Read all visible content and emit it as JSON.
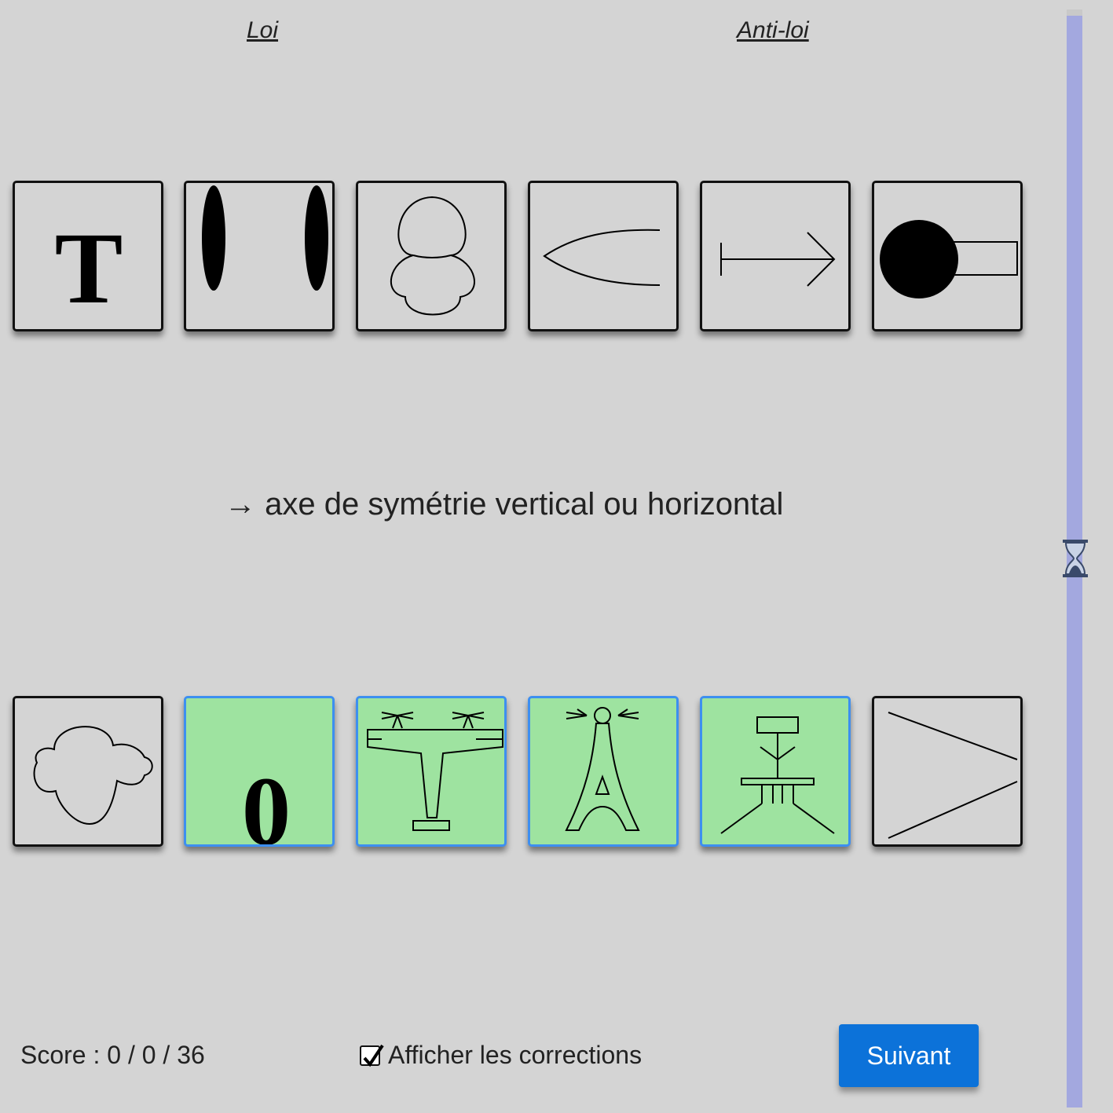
{
  "headers": {
    "law": "Loi",
    "anti_law": "Anti-loi"
  },
  "top_row": [
    {
      "id": "t1",
      "icon": "letter-T-icon",
      "letter": "T"
    },
    {
      "id": "t2",
      "icon": "two-vertical-ellipses-icon"
    },
    {
      "id": "t3",
      "icon": "stacked-bubble-shape-icon"
    },
    {
      "id": "t4",
      "icon": "lens-curve-icon"
    },
    {
      "id": "t5",
      "icon": "arrow-right-bar-icon"
    },
    {
      "id": "t6",
      "icon": "circle-with-rectangle-icon"
    }
  ],
  "rule_text": "→ axe de symétrie vertical ou horizontal",
  "bottom_row": [
    {
      "id": "b1",
      "icon": "cloud-blob-icon",
      "selected": false
    },
    {
      "id": "b2",
      "icon": "digit-zero-icon",
      "letter": "0",
      "selected": true
    },
    {
      "id": "b3",
      "icon": "airplane-topview-icon",
      "selected": true
    },
    {
      "id": "b4",
      "icon": "eiffel-tower-icon",
      "selected": true
    },
    {
      "id": "b5",
      "icon": "stick-figure-structure-icon",
      "selected": true
    },
    {
      "id": "b6",
      "icon": "greater-than-lines-icon",
      "selected": false
    }
  ],
  "footer": {
    "score": "Score : 0 / 0 / 36",
    "show_corrections_label": "Afficher les corrections",
    "show_corrections_checked": true,
    "next_label": "Suivant"
  },
  "colors": {
    "selected_bg": "#9ee3a0",
    "selected_border": "#3d8ff0",
    "button": "#0c72d9",
    "timer": "#a3a8df"
  }
}
